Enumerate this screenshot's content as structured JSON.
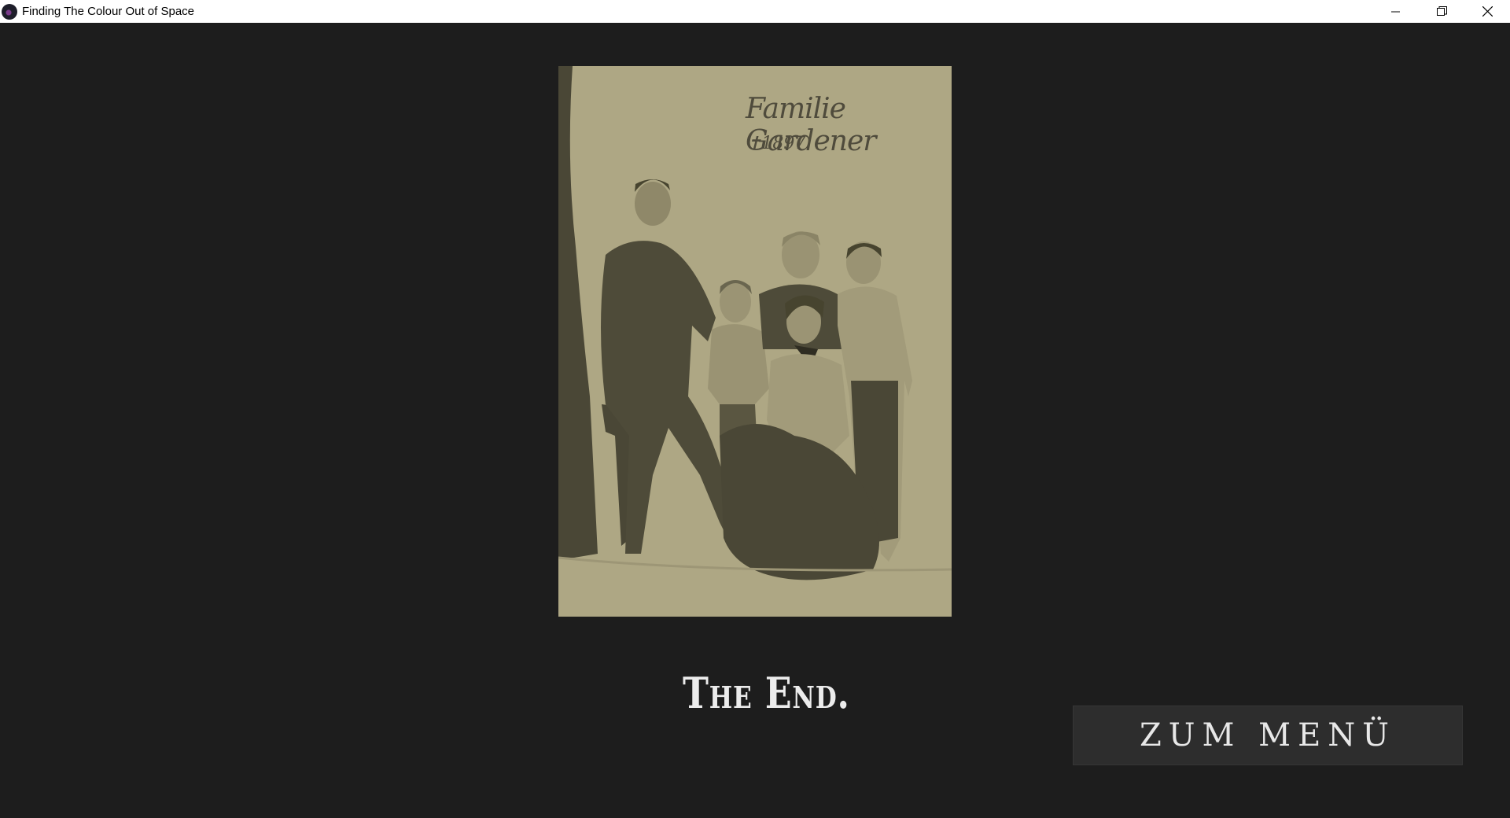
{
  "window": {
    "title": "Finding The Colour Out of Space",
    "icon": "game-logo-icon",
    "controls": [
      "minimize-icon",
      "restore-icon",
      "close-icon"
    ]
  },
  "portrait": {
    "caption_name": "Familie Gardener",
    "caption_year": "✝1897",
    "background": "#aea784"
  },
  "ending": {
    "text": "The End."
  },
  "menu_button": {
    "label": "ZUM MENÜ"
  },
  "colors": {
    "background": "#1d1d1d",
    "button": "#2d2d2d",
    "text": "#ececec"
  }
}
